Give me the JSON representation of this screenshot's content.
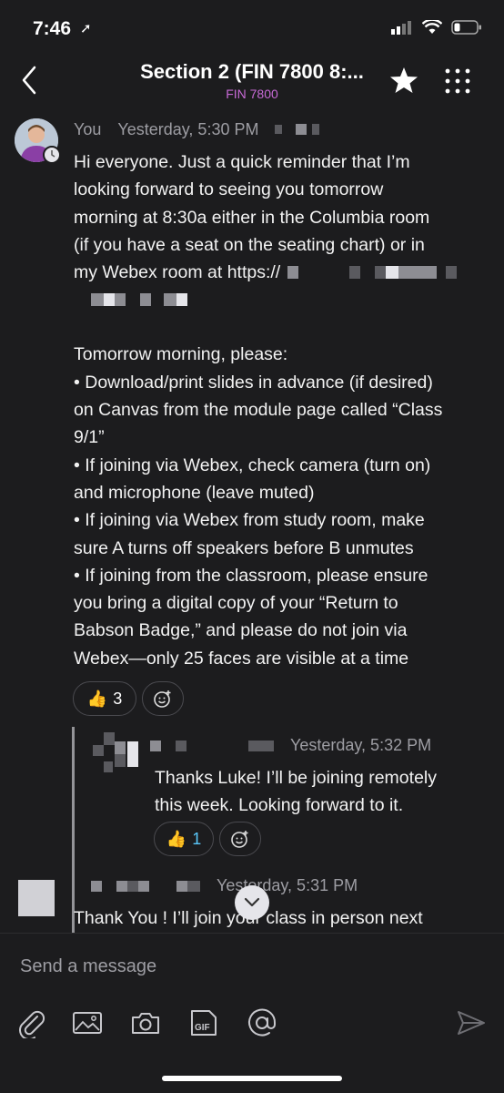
{
  "status_bar": {
    "time": "7:46",
    "location_arrow": "➚"
  },
  "header": {
    "title": "Section 2 (FIN 7800 8:...",
    "subtitle": "FIN 7800"
  },
  "messages": [
    {
      "sender": "You",
      "timestamp": "Yesterday, 5:30 PM",
      "paragraph1_lines": [
        "Hi everyone. Just a quick reminder that I’m",
        "looking forward to seeing you tomorrow",
        "morning at 8:30a either in the Columbia room",
        "(if you have a seat on the seating chart) or in",
        "my Webex room at https://"
      ],
      "paragraph2_lines": [
        "Tomorrow morning, please:",
        "• Download/print slides in advance (if desired)",
        "on Canvas from the module page called “Class",
        "9/1”",
        "• If joining via Webex, check camera (turn on)",
        "and microphone (leave muted)",
        "• If joining via Webex from study room, make",
        "sure A turns off speakers before B unmutes",
        "• If joining from the classroom, please ensure",
        "you bring a digital copy of your “Return to",
        "Babson Badge,” and please do not join via",
        "Webex—only 25 faces are visible at a time"
      ],
      "reaction_count": "3"
    },
    {
      "timestamp": "Yesterday, 5:32 PM",
      "lines": [
        "Thanks Luke! I’ll be joining remotely",
        "this week. Looking forward to it."
      ],
      "reaction_count": "1"
    },
    {
      "timestamp": "Yesterday, 5:31 PM",
      "text": "Thank You ! I’ll join your class in person next"
    }
  ],
  "composer": {
    "placeholder": "Send a message"
  },
  "icons": {
    "back": "chevron-left-icon",
    "star": "star-icon",
    "menu": "grid-dots-icon",
    "attach": "paperclip-icon",
    "image": "image-icon",
    "camera": "camera-icon",
    "gif": "gif-icon",
    "mention": "at-icon",
    "send": "send-icon",
    "scroll": "chevron-down-icon"
  },
  "colors": {
    "background": "#1c1c1e",
    "accent": "#c76ad6",
    "text_muted": "#9d9da3"
  }
}
